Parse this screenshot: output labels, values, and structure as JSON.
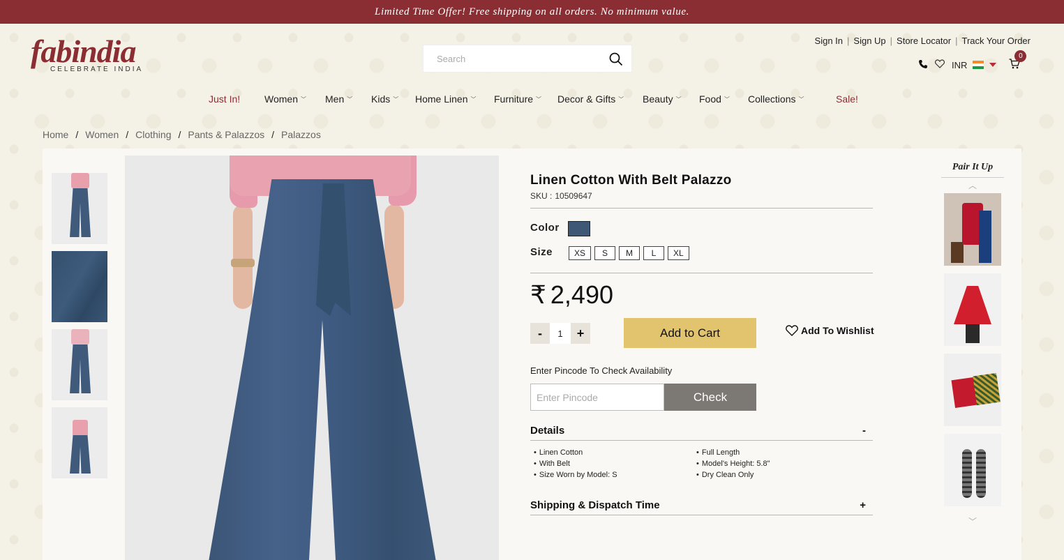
{
  "promo": "Limited Time Offer! Free shipping on all orders. No minimum value.",
  "logo": {
    "word": "fabindia",
    "tagline": "CELEBRATE INDIA"
  },
  "search": {
    "placeholder": "Search"
  },
  "header_links": [
    "Sign In",
    "Sign Up",
    "Store Locator",
    "Track Your Order"
  ],
  "currency": "INR",
  "cart_count": "0",
  "nav": [
    "Just In!",
    "Women",
    "Men",
    "Kids",
    "Home Linen",
    "Furniture",
    "Decor & Gifts",
    "Beauty",
    "Food",
    "Collections",
    "Sale!"
  ],
  "breadcrumb": [
    "Home",
    "Women",
    "Clothing",
    "Pants & Palazzos",
    "Palazzos"
  ],
  "product": {
    "title": "Linen Cotton With Belt Palazzo",
    "sku_label": "SKU :",
    "sku": "10509647",
    "color_label": "Color",
    "size_label": "Size",
    "sizes": [
      "XS",
      "S",
      "M",
      "L",
      "XL"
    ],
    "currency_symbol": "₹",
    "price": "2,490",
    "qty": "1",
    "qty_minus": "-",
    "qty_plus": "+",
    "add_to_cart": "Add to Cart",
    "wishlist": "Add To Wishlist",
    "pincode_label": "Enter Pincode To Check Availability",
    "pincode_placeholder": "Enter Pincode",
    "check": "Check",
    "details_label": "Details",
    "details_toggle": "-",
    "details": [
      "Linen Cotton",
      "Full Length",
      "With Belt",
      "Model's Height: 5.8\"",
      "Size Worn by Model: S",
      "Dry Clean Only"
    ],
    "shipping_label": "Shipping & Dispatch Time",
    "shipping_toggle": "+"
  },
  "pair_it_up": {
    "title": "Pair It Up"
  },
  "colors": {
    "brand": "#8b2e33",
    "add_to_cart": "#e3c46e",
    "check_button": "#7c7873",
    "swatch": "#3f5876"
  }
}
